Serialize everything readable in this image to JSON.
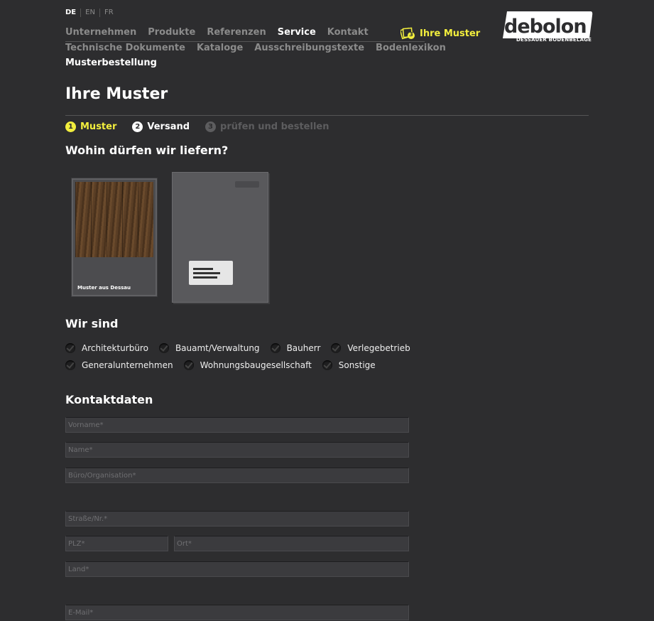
{
  "languages": [
    "DE",
    "EN",
    "FR"
  ],
  "nav": {
    "main": [
      "Unternehmen",
      "Produkte",
      "Referenzen",
      "Service",
      "Kontakt"
    ],
    "active": "Service",
    "sub": [
      "Technische Dokumente",
      "Kataloge",
      "Ausschreibungstexte",
      "Bodenlexikon"
    ],
    "current": "Musterbestellung",
    "muster_link": "Ihre Muster",
    "muster_count": "3"
  },
  "logo": {
    "name": "debolon",
    "tagline": "DESSAUER BODENBELÄGE"
  },
  "page_title": "Ihre Muster",
  "steps": [
    {
      "num": "1",
      "label": "Muster"
    },
    {
      "num": "2",
      "label": "Versand"
    },
    {
      "num": "3",
      "label": "prüfen und bestellen"
    }
  ],
  "delivery_heading": "Wohin dürfen wir liefern?",
  "option_sample_label": "Muster aus Dessau",
  "wir_sind": {
    "heading": "Wir sind",
    "row1": [
      "Architekturbüro",
      "Bauamt/Verwaltung",
      "Bauherr",
      "Verlegebetrieb"
    ],
    "row2": [
      "Generalunternehmen",
      "Wohnungsbaugesellschaft",
      "Sonstige"
    ]
  },
  "contact": {
    "heading": "Kontaktdaten",
    "placeholders": {
      "vorname": "Vorname*",
      "name": "Name*",
      "buero": "Büro/Organisation*",
      "strasse": "Straße/Nr.*",
      "plz": "PLZ*",
      "ort": "Ort*",
      "land": "Land*",
      "email": "E-Mail*"
    }
  },
  "colors": {
    "accent": "#f2ee3d",
    "background": "#2d2d2f"
  }
}
